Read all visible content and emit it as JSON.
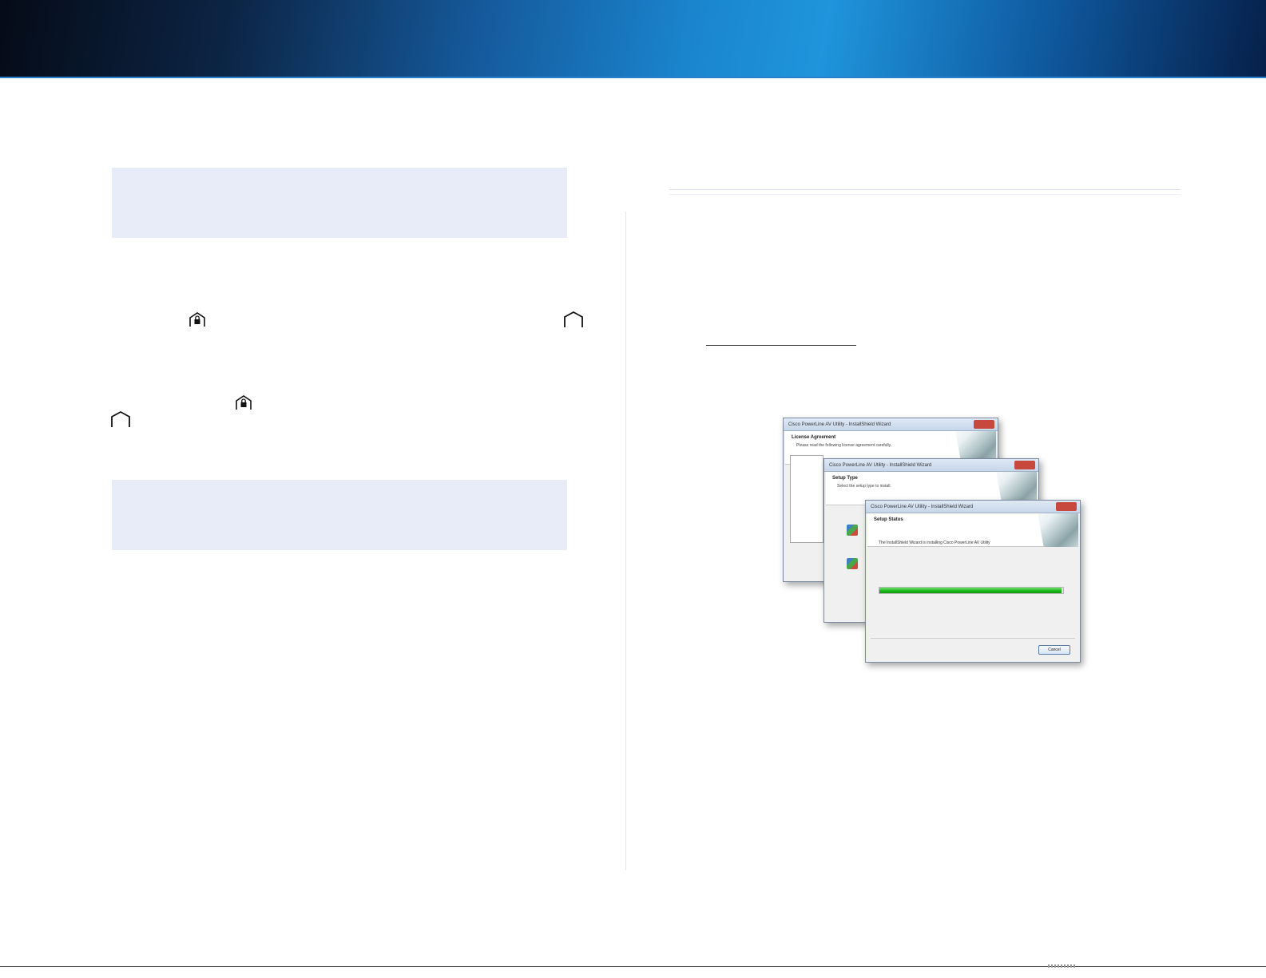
{
  "windows": {
    "license": {
      "title": "Cisco PowerLine AV Utility - InstallShield Wizard",
      "header_title": "License Agreement",
      "header_subtitle": "Please read the following license agreement carefully."
    },
    "setup_type": {
      "title": "Cisco PowerLine AV Utility - InstallShield Wizard",
      "header_title": "Setup Type",
      "header_subtitle": "Select the setup type to install."
    },
    "setup_status": {
      "title": "Cisco PowerLine AV Utility - InstallShield Wizard",
      "header_title": "Setup Status",
      "body_text": "The InstallShield Wizard is installing Cisco PowerLine AV Utility",
      "cancel_label": "Cancel",
      "progress": 0.99
    }
  }
}
